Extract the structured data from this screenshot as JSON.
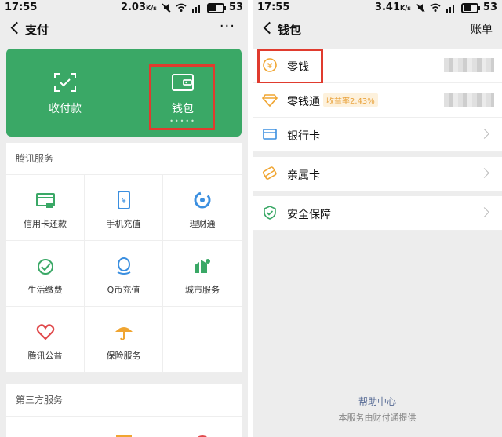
{
  "left": {
    "status": {
      "time": "17:55",
      "speed": "2.03",
      "speed_unit": "K/s",
      "battery": "53"
    },
    "nav": {
      "title": "支付",
      "more": "···"
    },
    "green_card": {
      "receive_label": "收付款",
      "wallet_label": "钱包",
      "wallet_dots": "•••••"
    },
    "tencent_services": {
      "title": "腾讯服务",
      "items": [
        {
          "label": "信用卡还款",
          "icon": "credit-card-icon"
        },
        {
          "label": "手机充值",
          "icon": "phone-recharge-icon"
        },
        {
          "label": "理财通",
          "icon": "wealth-icon"
        },
        {
          "label": "生活缴费",
          "icon": "utility-icon"
        },
        {
          "label": "Q币充值",
          "icon": "qq-coin-icon"
        },
        {
          "label": "城市服务",
          "icon": "city-icon"
        },
        {
          "label": "腾讯公益",
          "icon": "charity-icon"
        },
        {
          "label": "保险服务",
          "icon": "insurance-icon"
        }
      ]
    },
    "third_party": {
      "title": "第三方服务"
    }
  },
  "right": {
    "status": {
      "time": "17:55",
      "speed": "3.41",
      "speed_unit": "K/s",
      "battery": "53"
    },
    "nav": {
      "title": "钱包",
      "action": "账单"
    },
    "items": [
      {
        "label": "零钱",
        "icon": "yuan-coin-icon"
      },
      {
        "label": "零钱通",
        "icon": "diamond-icon",
        "badge": "收益率2.43%"
      },
      {
        "label": "银行卡",
        "icon": "bank-card-icon"
      },
      {
        "label": "亲属卡",
        "icon": "family-card-icon"
      },
      {
        "label": "安全保障",
        "icon": "shield-icon"
      }
    ],
    "footer": {
      "help": "帮助中心",
      "provider": "本服务由财付通提供"
    }
  },
  "colors": {
    "green": "#3aa866",
    "highlight": "#e03b2e",
    "link": "#576b95",
    "badge": "#e9a23b"
  }
}
